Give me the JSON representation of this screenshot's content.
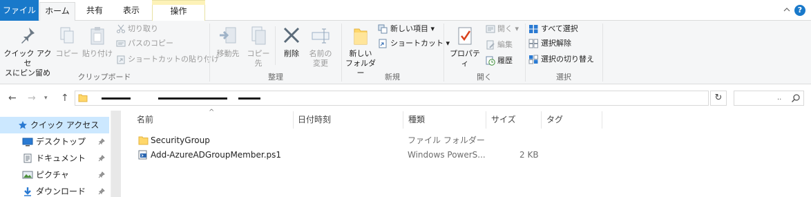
{
  "ribbon_tabs": {
    "file": "ファイル",
    "home": "ホーム",
    "share": "共有",
    "view": "表示",
    "manage": "操作"
  },
  "clipboard": {
    "pin_quick_access": [
      "クイック アクセ",
      "スにピン留め"
    ],
    "copy": "コピー",
    "paste": "貼り付け",
    "cut": "切り取り",
    "copy_path": "パスのコピー",
    "paste_shortcut": "ショートカットの貼り付け",
    "group_label": "クリップボード"
  },
  "organize": {
    "move_to": "移動先",
    "copy_to": "コピー先",
    "delete": "削除",
    "rename": [
      "名前の",
      "変更"
    ],
    "group_label": "整理"
  },
  "new_group": {
    "new_folder": [
      "新しい",
      "フォルダー"
    ],
    "new_item": "新しい項目",
    "shortcut": "ショートカット",
    "group_label": "新規"
  },
  "open_group": {
    "properties": "プロパティ",
    "open": "開く",
    "edit": "編集",
    "history": "履歴",
    "group_label": "開く"
  },
  "select_group": {
    "select_all": "すべて選択",
    "select_none": "選択解除",
    "invert_selection": "選択の切り替え",
    "group_label": "選択"
  },
  "search": {
    "placeholder": ".."
  },
  "nav_pane": [
    {
      "label": "クイック アクセス",
      "icon": "star-icon",
      "pinned": false
    },
    {
      "label": "デスクトップ",
      "icon": "desktop-icon",
      "pinned": true
    },
    {
      "label": "ドキュメント",
      "icon": "document-icon",
      "pinned": true
    },
    {
      "label": "ピクチャ",
      "icon": "pictures-icon",
      "pinned": true
    },
    {
      "label": "ダウンロード",
      "icon": "download-icon",
      "pinned": true
    }
  ],
  "columns": {
    "name": "名前",
    "date": "日付時刻",
    "type": "種類",
    "size": "サイズ",
    "tags": "タグ"
  },
  "files": [
    {
      "name": "SecurityGroup",
      "type": "ファイル フォルダー",
      "size": "",
      "icon": "folder-icon"
    },
    {
      "name": "Add-AzureADGroupMember.ps1",
      "type": "Windows PowerS...",
      "size": "2 KB",
      "icon": "powershell-script-icon"
    }
  ],
  "colors": {
    "file_tab": "#1979ca",
    "ribbon_bg": "#f5f6f7",
    "manage_tab_accent": "#fdf2b8",
    "nav_selected": "#cce8ff",
    "folder_yellow": "#ffd76a"
  }
}
